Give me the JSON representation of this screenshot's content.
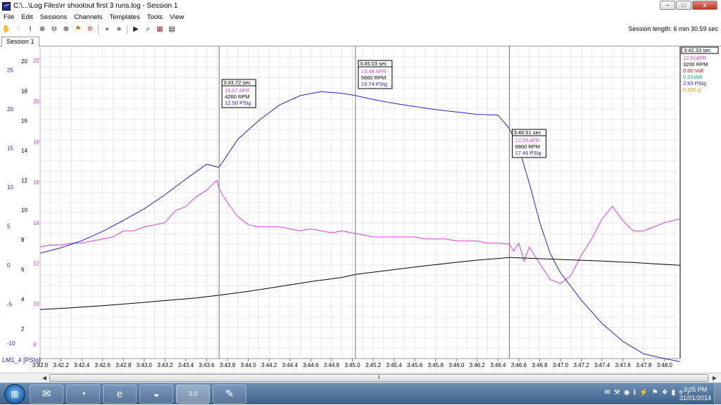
{
  "window": {
    "title": "C:\\...\\Log Files\\rr shootout first 3 runs.log - Session 1",
    "min_label": "–",
    "max_label": "□",
    "close_label": "x"
  },
  "menu": [
    "File",
    "Edit",
    "Sessions",
    "Channels",
    "Templates",
    "Tools",
    "View"
  ],
  "toolbar_icons": [
    "hand-icon",
    "hand-outline-icon",
    "text-cursor-icon",
    "zoom-in-icon",
    "zoom-out-icon",
    "zoom-fit-icon",
    "marker-icon",
    "fx-icon",
    "record-icon",
    "stop-icon",
    "play-icon",
    "binoculars-icon",
    "chart-settings-icon",
    "table-icon"
  ],
  "session_length": "Session length:  6 min 30.59 sec",
  "tab": "Session 1",
  "colors": {
    "afr": "#e03ce0",
    "rpm": "#000000",
    "volt_red": "#e00000",
    "volt_green": "#00aa66",
    "psig": "#2222cc",
    "g": "#e08a00",
    "grid": "#dddddd"
  },
  "chart_data": {
    "type": "line",
    "x_channel_label": "LM1_4 [PSIg]",
    "x_ticks": [
      "3:42.0",
      "3:42.2",
      "3:42.4",
      "3:42.6",
      "3:42.8",
      "3:43.0",
      "3:43.2",
      "3:43.4",
      "3:43.6",
      "3:43.8",
      "3:44.0",
      "3:44.2",
      "3:44.4",
      "3:44.6",
      "3:44.8",
      "3:45.0",
      "3:45.2",
      "3:45.4",
      "3:45.6",
      "3:45.8",
      "3:46.0",
      "3:46.2",
      "3:46.4",
      "3:46.6",
      "3:46.8",
      "3:47.0",
      "3:47.2",
      "3:47.4",
      "3:47.6",
      "3:47.8",
      "3:48.0"
    ],
    "xlim": [
      222.0,
      228.15
    ],
    "y_axes": {
      "psig": {
        "ticks": [
          "25",
          "20",
          "15",
          "10",
          "5",
          "0",
          "-5",
          "-10"
        ],
        "ylim": [
          -12,
          28
        ]
      },
      "rpm_k": {
        "ticks": [
          "20",
          "18",
          "16",
          "14",
          "12",
          "10",
          "8",
          "6",
          "4",
          "2"
        ],
        "ylim": [
          0,
          21
        ]
      },
      "afr": {
        "ticks": [
          "22",
          "20",
          "18",
          "16",
          "14",
          "12",
          "10",
          "8"
        ],
        "ylim": [
          7.3,
          22.7
        ]
      }
    },
    "series": [
      {
        "name": "AFR",
        "key": "afr",
        "x": [
          222.0,
          222.1,
          222.2,
          222.3,
          222.4,
          222.5,
          222.6,
          222.7,
          222.8,
          222.9,
          223.0,
          223.1,
          223.2,
          223.3,
          223.4,
          223.5,
          223.6,
          223.7,
          223.72,
          223.8,
          223.9,
          224.0,
          224.1,
          224.2,
          224.3,
          224.4,
          224.5,
          224.6,
          224.7,
          224.8,
          224.9,
          225.0,
          225.03,
          225.1,
          225.2,
          225.3,
          225.4,
          225.5,
          225.6,
          225.7,
          225.8,
          225.9,
          226.0,
          226.1,
          226.2,
          226.3,
          226.4,
          226.51,
          226.55,
          226.6,
          226.65,
          226.7,
          226.8,
          226.9,
          227.0,
          227.1,
          227.2,
          227.3,
          227.4,
          227.5,
          227.6,
          227.7,
          227.8,
          227.9,
          228.0,
          228.15
        ],
        "y": [
          12.8,
          12.9,
          12.9,
          13.0,
          13.0,
          13.1,
          13.2,
          13.3,
          13.6,
          13.6,
          13.8,
          13.9,
          14.0,
          14.6,
          14.8,
          15.3,
          15.6,
          16.1,
          15.67,
          15.0,
          14.3,
          13.9,
          13.8,
          13.8,
          13.8,
          13.7,
          13.6,
          13.7,
          13.6,
          13.5,
          13.6,
          13.5,
          13.48,
          13.4,
          13.3,
          13.3,
          13.3,
          13.3,
          13.3,
          13.2,
          13.2,
          13.2,
          13.1,
          13.1,
          13.1,
          13.0,
          13.0,
          12.95,
          12.6,
          13.0,
          12.1,
          12.8,
          12.0,
          11.2,
          11.0,
          11.4,
          12.4,
          13.2,
          14.2,
          14.8,
          14.1,
          13.6,
          13.6,
          13.8,
          14.0,
          14.2
        ]
      },
      {
        "name": "RPM",
        "key": "rpm",
        "x": [
          222.0,
          222.3,
          222.6,
          222.9,
          223.2,
          223.5,
          223.72,
          224.0,
          224.3,
          224.6,
          224.9,
          225.03,
          225.3,
          225.6,
          225.9,
          226.2,
          226.51,
          226.8,
          227.1,
          227.4,
          227.7,
          228.0,
          228.15
        ],
        "y": [
          3300,
          3420,
          3560,
          3720,
          3900,
          4080,
          4260,
          4520,
          4850,
          5180,
          5460,
          5660,
          5900,
          6160,
          6400,
          6620,
          6800,
          6720,
          6640,
          6560,
          6460,
          6340,
          6280
        ]
      },
      {
        "name": "PSIg",
        "key": "psig",
        "x": [
          222.0,
          222.2,
          222.4,
          222.6,
          222.8,
          223.0,
          223.2,
          223.4,
          223.6,
          223.72,
          223.9,
          224.1,
          224.3,
          224.5,
          224.7,
          224.9,
          225.03,
          225.2,
          225.4,
          225.6,
          225.8,
          226.0,
          226.2,
          226.4,
          226.51,
          226.6,
          226.7,
          226.8,
          226.9,
          227.0,
          227.2,
          227.4,
          227.6,
          227.8,
          228.0,
          228.15
        ],
        "y": [
          1.5,
          2.2,
          3.1,
          4.3,
          5.7,
          7.2,
          9.0,
          11.0,
          12.9,
          12.5,
          16.1,
          18.5,
          20.5,
          21.7,
          22.2,
          22.0,
          21.7,
          21.2,
          20.7,
          20.3,
          19.9,
          19.6,
          19.3,
          19.2,
          17.46,
          15.0,
          10.5,
          5.5,
          1.5,
          -1.0,
          -4.5,
          -7.5,
          -9.8,
          -11.4,
          -12.0,
          -12.4
        ]
      }
    ],
    "cursors": [
      {
        "x": 223.72,
        "time": "3:43.72 sec",
        "afr": "15.67 AFR",
        "rpm": "4260 RPM",
        "psig": "12.50 PSIg"
      },
      {
        "x": 225.03,
        "time": "3:45.03 sec",
        "afr": "13.48 AFR",
        "rpm": "5660 RPM",
        "psig": "19.74 PSIg"
      },
      {
        "x": 226.51,
        "time": "3:46.51 sec",
        "afr": "12.95 AFR",
        "rpm": "6800 RPM",
        "psig": "17.46 PSIg"
      }
    ],
    "readout": {
      "time": "3:42.33 sec",
      "afr": "12.51AFR",
      "rpm": "3200 RPM",
      "volt_red": "0.00 Volt",
      "volt_green": "0.01Volt",
      "psig": "2.63 PSIg",
      "g": "0.535 g"
    }
  },
  "taskbar": {
    "start_label": "⊞",
    "apps": [
      {
        "name": "outlook",
        "icon": "✉"
      },
      {
        "name": "media",
        "icon": "◔"
      },
      {
        "name": "ie",
        "icon": "e"
      },
      {
        "name": "gauge",
        "icon": "◒"
      },
      {
        "name": "logworks",
        "icon": "3.0"
      },
      {
        "name": "paint",
        "icon": "✎"
      }
    ],
    "tray_icons": [
      "✉",
      "⚒",
      "◉",
      "ℹ",
      "⚡",
      "⚑",
      "❖",
      "▮",
      "≡",
      "♪"
    ],
    "time": "3:05 PM",
    "date": "31/01/2014"
  }
}
